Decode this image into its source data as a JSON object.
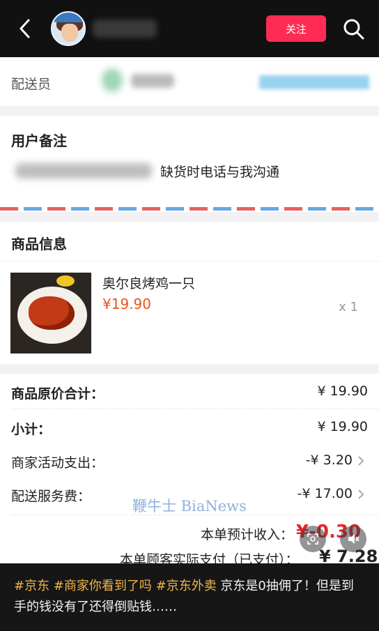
{
  "header": {
    "follow_label": "关注"
  },
  "courier": {
    "label": "配送员"
  },
  "remark": {
    "title": "用户备注",
    "text": "缺货时电话与我沟通"
  },
  "goods": {
    "title": "商品信息",
    "item": {
      "name": "奥尔良烤鸡一只",
      "price": "¥19.90",
      "quantity": "x 1"
    }
  },
  "summary": {
    "original_total_label": "商品原价合计：",
    "original_total_value": "¥ 19.90",
    "subtotal_label": "小计：",
    "subtotal_value": "¥ 19.90",
    "merchant_activity_label": "商家活动支出：",
    "merchant_activity_value": "-¥ 3.20",
    "delivery_fee_label": "配送服务费：",
    "delivery_fee_value": "-¥ 17.00",
    "income_label": "本单预计收入：",
    "income_value": "¥-0.30",
    "paid_label": "本单顾客实际支付（已支付）：",
    "paid_value": "¥ 7.28"
  },
  "watermark": "鞭牛士 BiaNews",
  "caption": {
    "tags": "#京东 #商家你看到了吗 #京东外卖",
    "text": " 京东是0抽佣了！但是到手的钱没有了还得倒贴钱……"
  },
  "colors": {
    "follow_button": "#fe2c55",
    "price": "#e8541d",
    "income_negative": "#e8232b",
    "hashtag": "#f0b54a"
  },
  "icons": [
    "back-arrow-icon",
    "search-icon",
    "chevron-right-icon",
    "screenshot-icon",
    "mute-icon"
  ]
}
